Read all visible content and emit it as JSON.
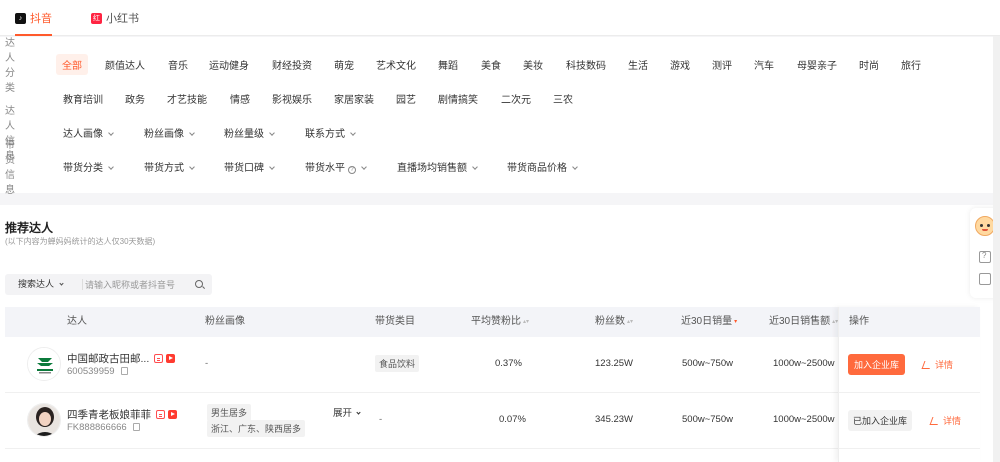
{
  "platform_tabs": [
    {
      "label": "抖音",
      "icon": "douyin-icon",
      "active": true
    },
    {
      "label": "小红书",
      "icon": "xiaohongshu-icon",
      "active": false
    }
  ],
  "filters": {
    "category_label": "达人分类",
    "categories_row1": [
      "全部",
      "颜值达人",
      "音乐",
      "运动健身",
      "财经投资",
      "萌宠",
      "艺术文化",
      "舞蹈",
      "美食",
      "美妆",
      "科技数码",
      "生活",
      "游戏",
      "测评",
      "汽车",
      "母婴亲子",
      "时尚",
      "旅行"
    ],
    "categories_row2": [
      "教育培训",
      "政务",
      "才艺技能",
      "情感",
      "影视娱乐",
      "家居家装",
      "园艺",
      "剧情搞笑",
      "二次元",
      "三农"
    ],
    "influencer_info_label": "达人信息",
    "influencer_info": [
      "达人画像",
      "粉丝画像",
      "粉丝量级",
      "联系方式"
    ],
    "sales_info_label": "带货信息",
    "sales_info": [
      "带货分类",
      "带货方式",
      "带货口碑",
      "带货水平",
      "直播场均销售额",
      "带货商品价格"
    ]
  },
  "section": {
    "title": "推荐达人",
    "subtitle": "(以下内容为蝉妈妈统计的达人仅30天数据)",
    "search_select": "搜索达人",
    "search_placeholder": "请输入昵称或者抖音号"
  },
  "table": {
    "columns": [
      "达人",
      "粉丝画像",
      "带货类目",
      "平均赞粉比",
      "粉丝数",
      "近30日销量",
      "近30日销售额",
      "操作"
    ],
    "rows": [
      {
        "name": "中国邮政古田邮...",
        "id": "600539959",
        "fan_profile": "-",
        "fan_tags": [],
        "category": "食品饮料",
        "like_fan_ratio": "0.37%",
        "fans": "123.25W",
        "sales_30d": "500w~750w",
        "revenue_30d": "1000w~2500w",
        "action": "加入企业库",
        "action_state": "primary",
        "detail": "详情"
      },
      {
        "name": "四季青老板娘菲菲",
        "id": "FK888866666",
        "fan_profile": "",
        "fan_tags": [
          "男生居多",
          "浙江、广东、陕西居多"
        ],
        "expand": "展开",
        "category": "-",
        "like_fan_ratio": "0.07%",
        "fans": "345.23W",
        "sales_30d": "500w~750w",
        "revenue_30d": "1000w~2500w",
        "action": "已加入企业库",
        "action_state": "added",
        "detail": "详情"
      }
    ]
  },
  "colors": {
    "accent": "#ff5a2c",
    "button": "#ff6a3d"
  }
}
